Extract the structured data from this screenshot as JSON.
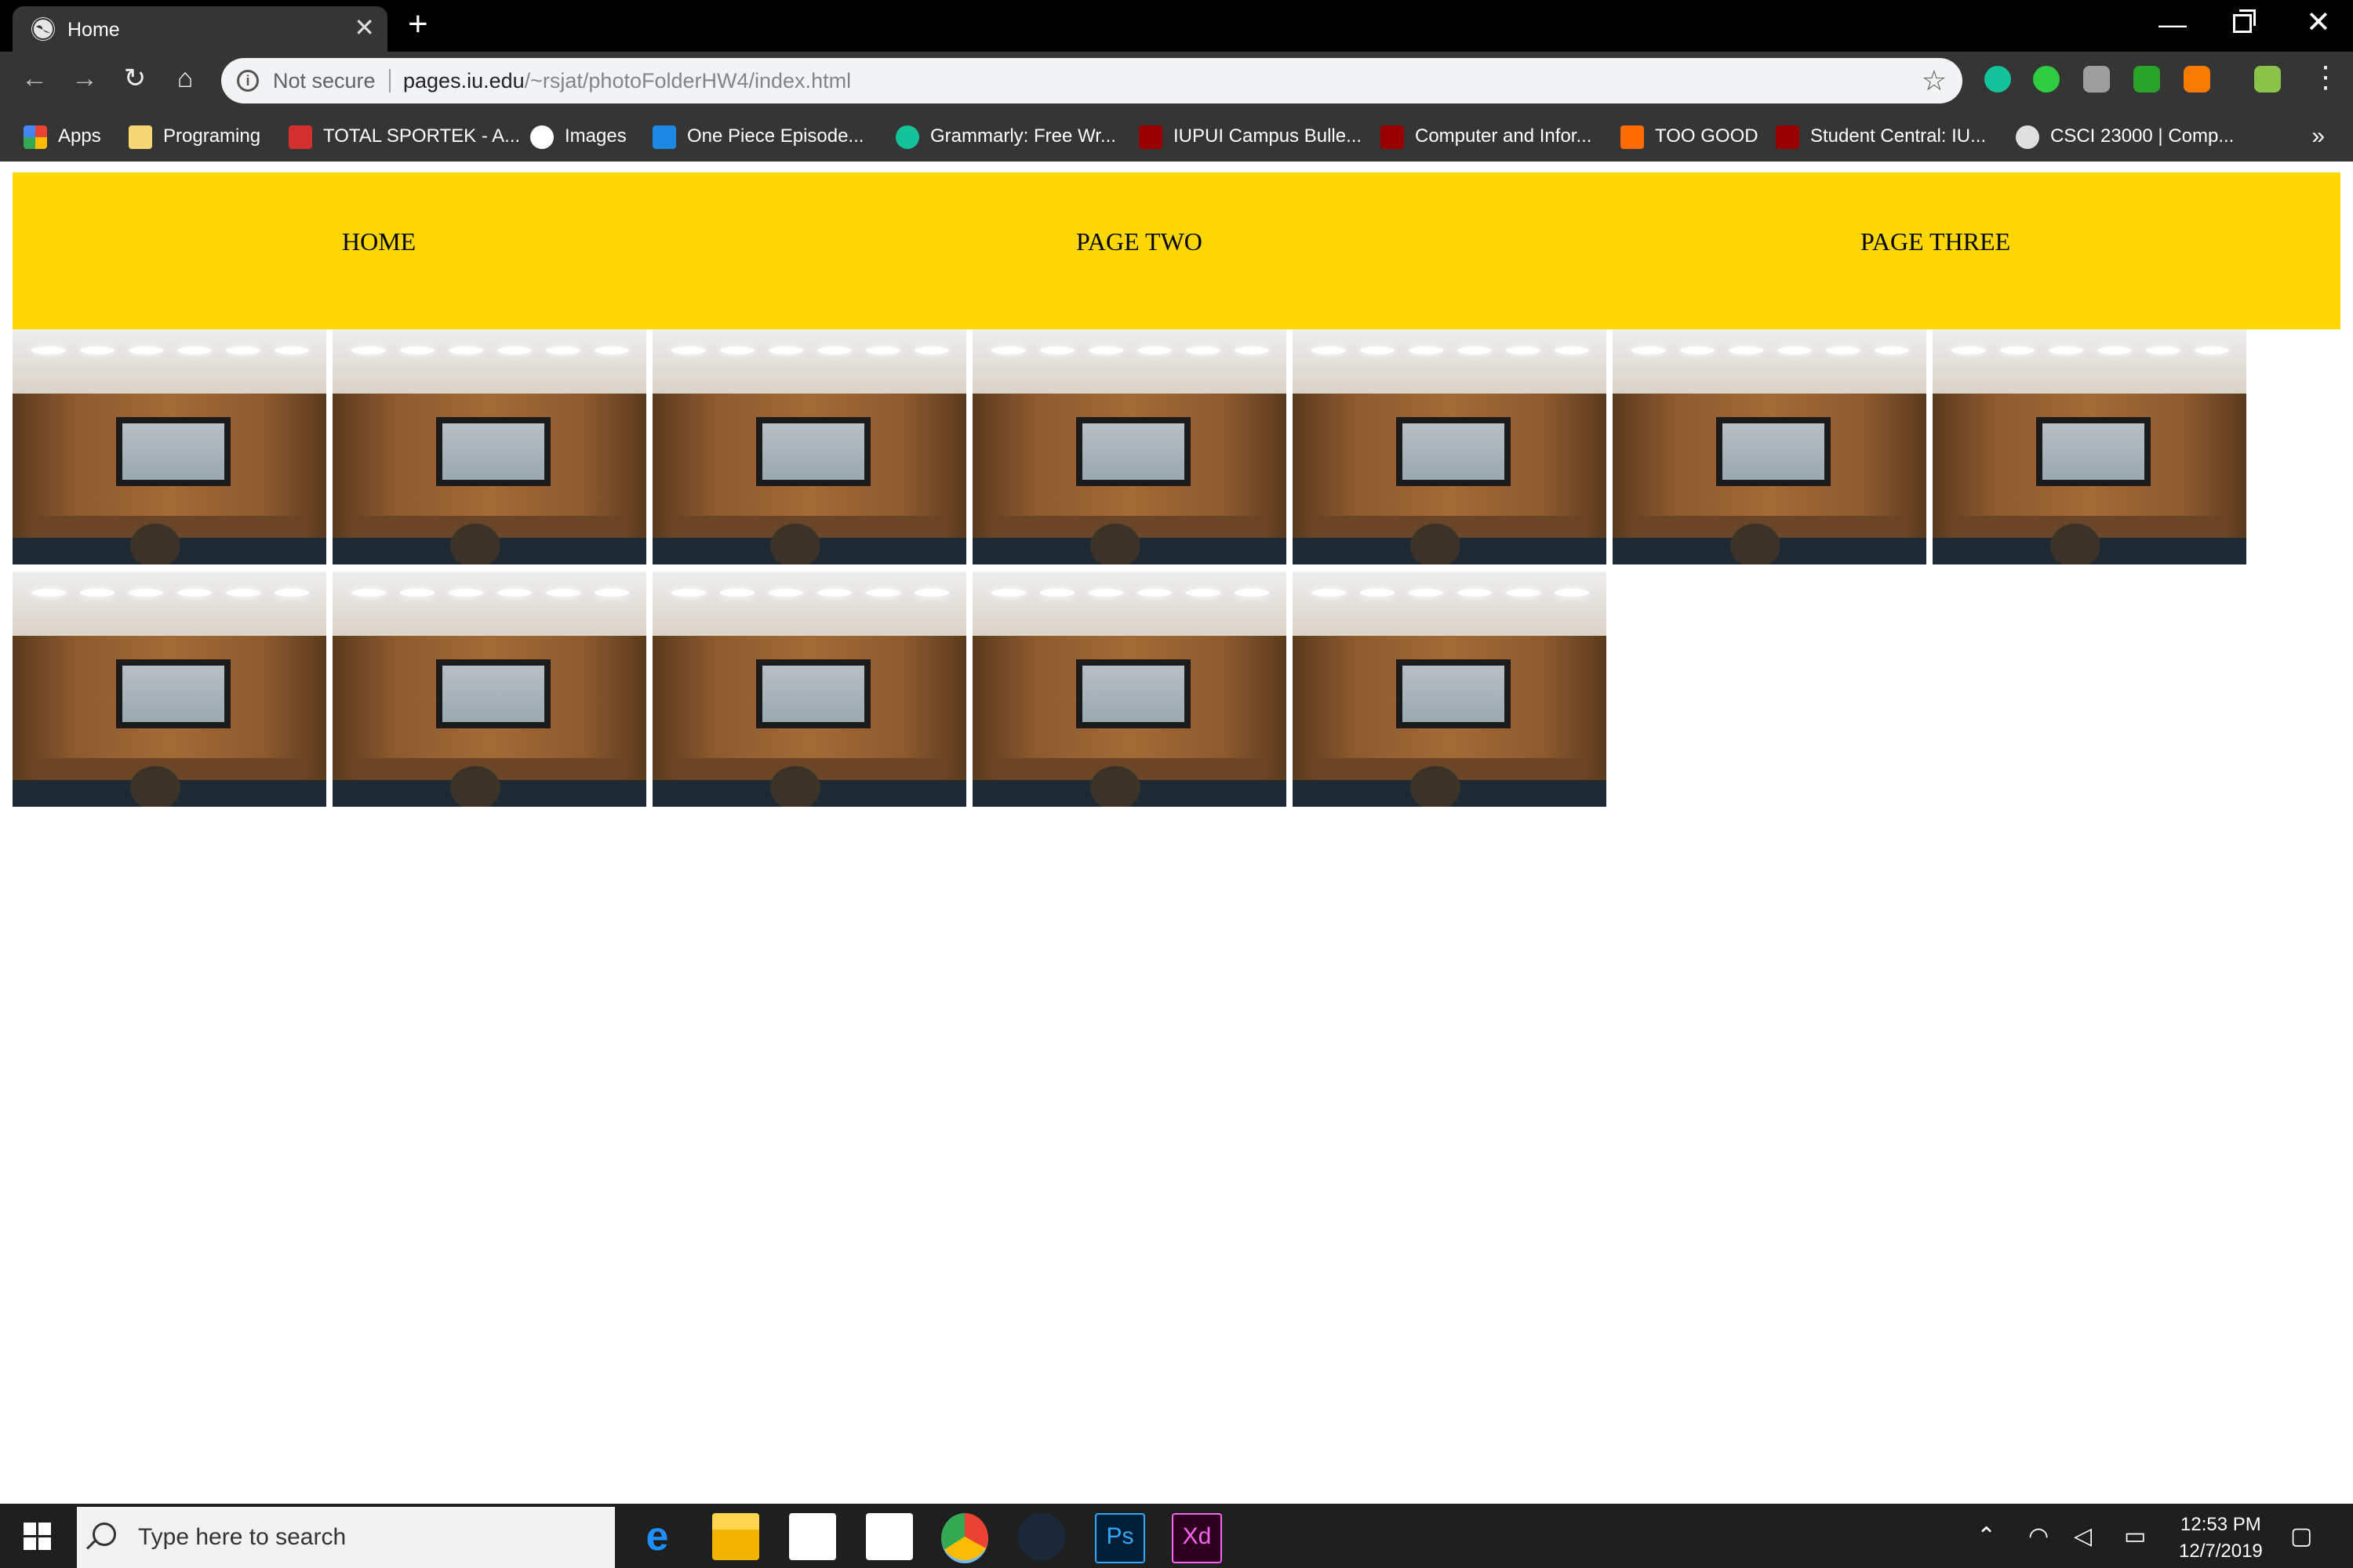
{
  "browser": {
    "tab_title": "Home",
    "tab_close": "✕",
    "new_tab": "+",
    "omnibox": {
      "security_label": "Not secure",
      "url_host": "pages.iu.edu",
      "url_path": "/~rsjat/photoFolderHW4/index.html"
    },
    "bookmarks": [
      {
        "label": "Apps",
        "icon": "apps-grid-icon",
        "color": "#ea4335"
      },
      {
        "label": "Programing",
        "icon": "folder-icon",
        "color": "#f7d774"
      },
      {
        "label": "TOTAL SPORTEK - A...",
        "icon": "ts-logo-icon",
        "color": "#d32f2f"
      },
      {
        "label": "Images",
        "icon": "google-icon",
        "color": "#ffffff"
      },
      {
        "label": "One Piece Episode...",
        "icon": "a-logo-icon",
        "color": "#1e88e5"
      },
      {
        "label": "Grammarly: Free Wr...",
        "icon": "grammarly-icon",
        "color": "#15c39a"
      },
      {
        "label": "IUPUI Campus Bulle...",
        "icon": "iu-trident-icon",
        "color": "#990000"
      },
      {
        "label": "Computer and Infor...",
        "icon": "iu-trident-icon",
        "color": "#990000"
      },
      {
        "label": "TOO GOOD",
        "icon": "w-logo-icon",
        "color": "#ff6d00"
      },
      {
        "label": "Student Central: IU...",
        "icon": "iu-trident-icon",
        "color": "#990000"
      },
      {
        "label": "CSCI 23000 | Comp...",
        "icon": "globe-icon",
        "color": "#e0e0e0"
      }
    ],
    "bookmarks_more": "»"
  },
  "page": {
    "nav": {
      "links": [
        "HOME",
        "PAGE TWO",
        "PAGE THREE"
      ],
      "background": "#ffd700"
    },
    "gallery": {
      "row1_count": 7,
      "row2_count": 5,
      "photo_subject": "lecture hall with projection screen"
    }
  },
  "taskbar": {
    "search_placeholder": "Type here to search",
    "apps": [
      "edge-icon",
      "file-explorer-icon",
      "store-icon",
      "mail-icon",
      "chrome-icon",
      "steam-icon",
      "photoshop-icon",
      "xd-icon"
    ],
    "ps_label": "Ps",
    "xd_label": "Xd",
    "time": "12:53 PM",
    "date": "12/7/2019"
  }
}
